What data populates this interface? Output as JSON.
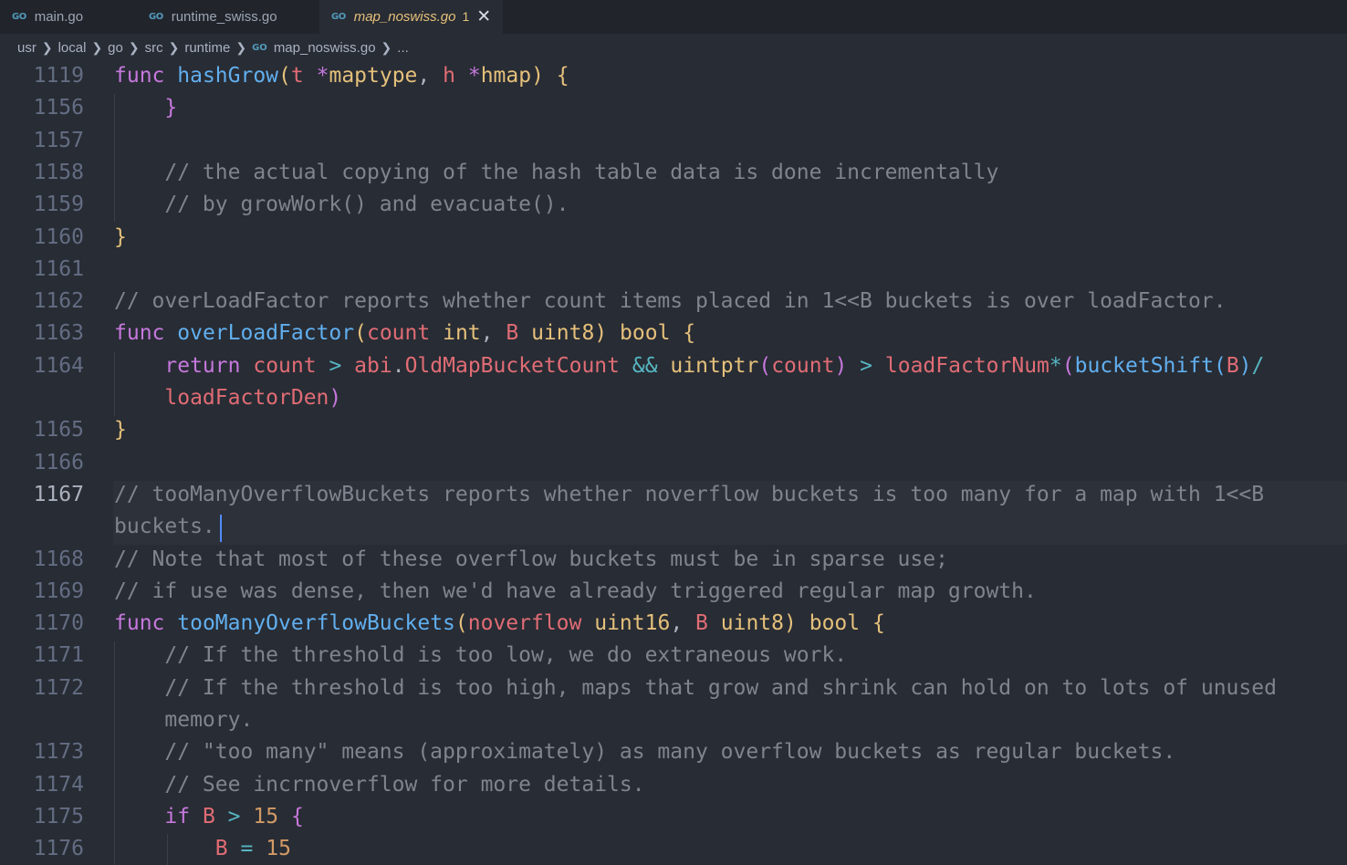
{
  "tabs": [
    {
      "icon": "GO",
      "label": "main.go"
    },
    {
      "icon": "GO",
      "label": "runtime_swiss.go"
    },
    {
      "icon": "GO",
      "label": "map_noswiss.go",
      "badge": "1",
      "close": "✕"
    }
  ],
  "breadcrumb": {
    "segments": [
      "usr",
      "local",
      "go",
      "src",
      "runtime"
    ],
    "file_icon": "GO",
    "file": "map_noswiss.go",
    "ellipsis": "..."
  },
  "editor": {
    "current_line": "1167",
    "lines": [
      {
        "num": "1119",
        "tokens": [
          {
            "t": "func",
            "c": "kw"
          },
          {
            "t": " "
          },
          {
            "t": "hashGrow",
            "c": "fn"
          },
          {
            "t": "(",
            "c": "br1"
          },
          {
            "t": "t",
            "c": "pa"
          },
          {
            "t": " "
          },
          {
            "t": "*",
            "c": "kw"
          },
          {
            "t": "maptype",
            "c": "ty"
          },
          {
            "t": ", "
          },
          {
            "t": "h",
            "c": "pa"
          },
          {
            "t": " "
          },
          {
            "t": "*",
            "c": "kw"
          },
          {
            "t": "hmap",
            "c": "ty"
          },
          {
            "t": ")",
            "c": "br1"
          },
          {
            "t": " "
          },
          {
            "t": "{",
            "c": "br1"
          }
        ]
      },
      {
        "num": "1156",
        "tokens": [
          {
            "t": "    "
          },
          {
            "t": "}",
            "c": "br2"
          }
        ]
      },
      {
        "num": "1157",
        "tokens": []
      },
      {
        "num": "1158",
        "tokens": [
          {
            "t": "    "
          },
          {
            "t": "// the actual copying of the hash table data is done incrementally",
            "c": "cm"
          }
        ]
      },
      {
        "num": "1159",
        "tokens": [
          {
            "t": "    "
          },
          {
            "t": "// by growWork() and evacuate().",
            "c": "cm"
          }
        ]
      },
      {
        "num": "1160",
        "tokens": [
          {
            "t": "}",
            "c": "br1"
          }
        ]
      },
      {
        "num": "1161",
        "tokens": []
      },
      {
        "num": "1162",
        "tokens": [
          {
            "t": "// overLoadFactor reports whether count items placed in 1<<B buckets is over loadFactor.",
            "c": "cm"
          }
        ]
      },
      {
        "num": "1163",
        "tokens": [
          {
            "t": "func",
            "c": "kw"
          },
          {
            "t": " "
          },
          {
            "t": "overLoadFactor",
            "c": "fn"
          },
          {
            "t": "(",
            "c": "br1"
          },
          {
            "t": "count",
            "c": "pa"
          },
          {
            "t": " "
          },
          {
            "t": "int",
            "c": "ty"
          },
          {
            "t": ", "
          },
          {
            "t": "B",
            "c": "pa"
          },
          {
            "t": " "
          },
          {
            "t": "uint8",
            "c": "ty"
          },
          {
            "t": ")",
            "c": "br1"
          },
          {
            "t": " "
          },
          {
            "t": "bool",
            "c": "ty"
          },
          {
            "t": " "
          },
          {
            "t": "{",
            "c": "br1"
          }
        ]
      },
      {
        "num": "1164",
        "tokens": [
          {
            "t": "    "
          },
          {
            "t": "return",
            "c": "kw"
          },
          {
            "t": " "
          },
          {
            "t": "count",
            "c": "pa"
          },
          {
            "t": " "
          },
          {
            "t": ">",
            "c": "op"
          },
          {
            "t": " "
          },
          {
            "t": "abi",
            "c": "pa"
          },
          {
            "t": "."
          },
          {
            "t": "OldMapBucketCount",
            "c": "pa"
          },
          {
            "t": " "
          },
          {
            "t": "&&",
            "c": "op"
          },
          {
            "t": " "
          },
          {
            "t": "uintptr",
            "c": "ty"
          },
          {
            "t": "(",
            "c": "br2"
          },
          {
            "t": "count",
            "c": "pa"
          },
          {
            "t": ")",
            "c": "br2"
          },
          {
            "t": " "
          },
          {
            "t": ">",
            "c": "op"
          },
          {
            "t": " "
          },
          {
            "t": "loadFactorNum",
            "c": "pa"
          },
          {
            "t": "*",
            "c": "op"
          },
          {
            "t": "(",
            "c": "br2"
          },
          {
            "t": "bucketShift",
            "c": "fn"
          },
          {
            "t": "(",
            "c": "br3"
          },
          {
            "t": "B",
            "c": "pa"
          },
          {
            "t": ")",
            "c": "br3"
          },
          {
            "t": "/",
            "c": "op"
          }
        ]
      },
      {
        "num": "",
        "tokens": [
          {
            "t": "    "
          },
          {
            "t": "loadFactorDen",
            "c": "pa"
          },
          {
            "t": ")",
            "c": "br2"
          }
        ]
      },
      {
        "num": "1165",
        "tokens": [
          {
            "t": "}",
            "c": "br1"
          }
        ]
      },
      {
        "num": "1166",
        "tokens": []
      },
      {
        "num": "1167",
        "tokens": [
          {
            "t": "// tooManyOverflowBuckets reports whether noverflow buckets is too many for a map with 1<<B",
            "c": "cm"
          }
        ]
      },
      {
        "num": "",
        "tokens": [
          {
            "t": "buckets.",
            "c": "cm"
          }
        ]
      },
      {
        "num": "1168",
        "tokens": [
          {
            "t": "// Note that most of these overflow buckets must be in sparse use;",
            "c": "cm"
          }
        ]
      },
      {
        "num": "1169",
        "tokens": [
          {
            "t": "// if use was dense, then we'd have already triggered regular map growth.",
            "c": "cm"
          }
        ]
      },
      {
        "num": "1170",
        "tokens": [
          {
            "t": "func",
            "c": "kw"
          },
          {
            "t": " "
          },
          {
            "t": "tooManyOverflowBuckets",
            "c": "fn"
          },
          {
            "t": "(",
            "c": "br1"
          },
          {
            "t": "noverflow",
            "c": "pa"
          },
          {
            "t": " "
          },
          {
            "t": "uint16",
            "c": "ty"
          },
          {
            "t": ", "
          },
          {
            "t": "B",
            "c": "pa"
          },
          {
            "t": " "
          },
          {
            "t": "uint8",
            "c": "ty"
          },
          {
            "t": ")",
            "c": "br1"
          },
          {
            "t": " "
          },
          {
            "t": "bool",
            "c": "ty"
          },
          {
            "t": " "
          },
          {
            "t": "{",
            "c": "br1"
          }
        ]
      },
      {
        "num": "1171",
        "tokens": [
          {
            "t": "    "
          },
          {
            "t": "// If the threshold is too low, we do extraneous work.",
            "c": "cm"
          }
        ]
      },
      {
        "num": "1172",
        "tokens": [
          {
            "t": "    "
          },
          {
            "t": "// If the threshold is too high, maps that grow and shrink can hold on to lots of unused",
            "c": "cm"
          }
        ]
      },
      {
        "num": "",
        "tokens": [
          {
            "t": "    "
          },
          {
            "t": "memory.",
            "c": "cm"
          }
        ]
      },
      {
        "num": "1173",
        "tokens": [
          {
            "t": "    "
          },
          {
            "t": "// \"too many\" means (approximately) as many overflow buckets as regular buckets.",
            "c": "cm"
          }
        ]
      },
      {
        "num": "1174",
        "tokens": [
          {
            "t": "    "
          },
          {
            "t": "// See incrnoverflow for more details.",
            "c": "cm"
          }
        ]
      },
      {
        "num": "1175",
        "tokens": [
          {
            "t": "    "
          },
          {
            "t": "if",
            "c": "kw"
          },
          {
            "t": " "
          },
          {
            "t": "B",
            "c": "pa"
          },
          {
            "t": " "
          },
          {
            "t": ">",
            "c": "op"
          },
          {
            "t": " "
          },
          {
            "t": "15",
            "c": "nu"
          },
          {
            "t": " "
          },
          {
            "t": "{",
            "c": "br2"
          }
        ]
      },
      {
        "num": "1176",
        "tokens": [
          {
            "t": "        "
          },
          {
            "t": "B",
            "c": "pa"
          },
          {
            "t": " "
          },
          {
            "t": "=",
            "c": "op"
          },
          {
            "t": " "
          },
          {
            "t": "15",
            "c": "nu"
          }
        ]
      }
    ]
  }
}
